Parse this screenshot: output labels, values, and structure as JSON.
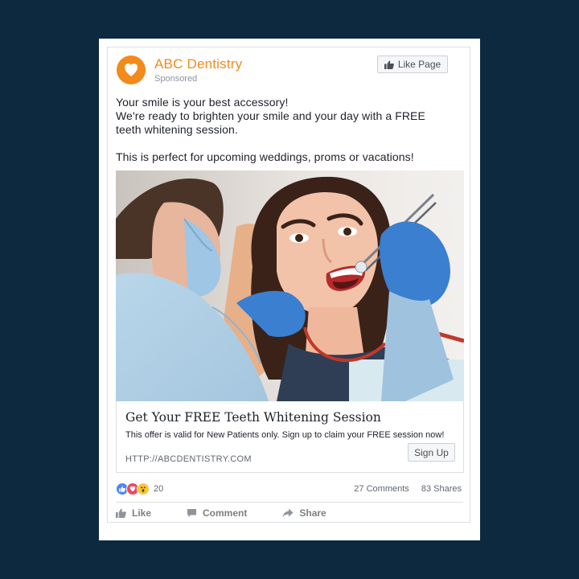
{
  "page": {
    "brand_name": "ABC Dentistry",
    "sponsored_label": "Sponsored",
    "like_page_label": "Like Page"
  },
  "post": {
    "lines": [
      "Your smile is your best accessory!",
      "We're ready to brighten your smile and your day with a FREE",
      "teeth whitening session.",
      "",
      "This is perfect for upcoming weddings, proms or vacations!"
    ]
  },
  "link_card": {
    "headline": "Get Your FREE Teeth Whitening Session",
    "description": "This offer is valid for New Patients only. Sign up to claim your FREE session now!",
    "url": "HTTP://ABCDENTISTRY.COM",
    "cta_label": "Sign Up"
  },
  "engagement": {
    "reaction_count": "20",
    "comments": "27 Comments",
    "shares": "83 Shares",
    "reaction_icons": [
      "like-icon",
      "love-icon",
      "wow-icon"
    ]
  },
  "actions": {
    "like": "Like",
    "comment": "Comment",
    "share": "Share"
  },
  "colors": {
    "background": "#0c2940",
    "brand_orange": "#f28a1c",
    "like_blue": "#4a84ff",
    "love_red": "#f0475f",
    "wow_yellow": "#f7c63a"
  }
}
